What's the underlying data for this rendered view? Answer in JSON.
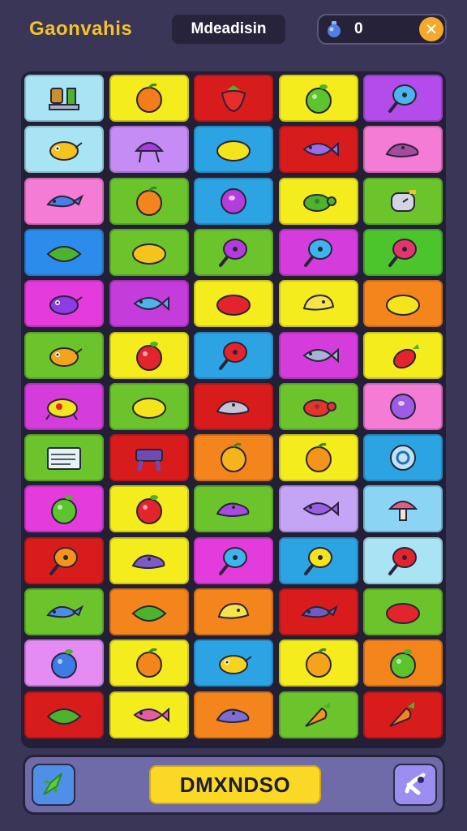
{
  "header": {
    "app_title": "Gaonvahis",
    "mode_label": "Mdeadisin",
    "coin_count": "0",
    "add_coins_symbol": "✕"
  },
  "board": {
    "rows": [
      [
        {
          "bg": "#a8e4f4",
          "icon": "trophy-icon",
          "color": "#c89030"
        },
        {
          "bg": "#f4ec1c",
          "icon": "orange-icon",
          "color": "#f47c1c"
        },
        {
          "bg": "#d81c1c",
          "icon": "strawberry-icon",
          "color": "#e82c2c"
        },
        {
          "bg": "#f4ec1c",
          "icon": "apple-icon",
          "color": "#5cc42c"
        },
        {
          "bg": "#b44cec",
          "icon": "lollipop-icon",
          "color": "#4cb4ec"
        }
      ],
      [
        {
          "bg": "#a8e4f4",
          "icon": "bird-icon",
          "color": "#f4c41c"
        },
        {
          "bg": "#c48cf4",
          "icon": "jellyfish-icon",
          "color": "#a43ce4"
        },
        {
          "bg": "#2ca4e4",
          "icon": "lemon-icon",
          "color": "#f4e41c"
        },
        {
          "bg": "#d81c1c",
          "icon": "fish-icon",
          "color": "#9c6ce4"
        },
        {
          "bg": "#f47cd4",
          "icon": "mouse-icon",
          "color": "#a44c9c"
        }
      ],
      [
        {
          "bg": "#f47cd4",
          "icon": "whale-icon",
          "color": "#4c7ce4"
        },
        {
          "bg": "#6cc42c",
          "icon": "orange-icon",
          "color": "#f4841c"
        },
        {
          "bg": "#2ca4e4",
          "icon": "plum-icon",
          "color": "#b43cdc"
        },
        {
          "bg": "#f4ec1c",
          "icon": "turtle-icon",
          "color": "#4cb42c"
        },
        {
          "bg": "#6cc42c",
          "icon": "watch-icon",
          "color": "#d4d4e4"
        }
      ],
      [
        {
          "bg": "#2c8cec",
          "icon": "leaf-icon",
          "color": "#4cb42c"
        },
        {
          "bg": "#6cc42c",
          "icon": "lemon-icon",
          "color": "#f4c41c"
        },
        {
          "bg": "#6cc42c",
          "icon": "lollipop-icon",
          "color": "#b43cdc"
        },
        {
          "bg": "#d43cdc",
          "icon": "lollipop-icon",
          "color": "#3cb4ec"
        },
        {
          "bg": "#4cc42c",
          "icon": "lollipop-icon",
          "color": "#e4346c"
        }
      ],
      [
        {
          "bg": "#e43cdc",
          "icon": "bird-icon",
          "color": "#8c3ce4"
        },
        {
          "bg": "#c43cdc",
          "icon": "fish-icon",
          "color": "#4cb4ec"
        },
        {
          "bg": "#f4ec1c",
          "icon": "lemon-icon",
          "color": "#e4242c"
        },
        {
          "bg": "#f4ec1c",
          "icon": "chick-icon",
          "color": "#f4e44c"
        },
        {
          "bg": "#f4841c",
          "icon": "lemon-icon",
          "color": "#f4e41c"
        }
      ],
      [
        {
          "bg": "#6cc42c",
          "icon": "bird-icon",
          "color": "#f4a41c"
        },
        {
          "bg": "#f4ec1c",
          "icon": "apple-icon",
          "color": "#e4242c"
        },
        {
          "bg": "#2ca4e4",
          "icon": "lollipop-icon",
          "color": "#e4242c"
        },
        {
          "bg": "#d43cdc",
          "icon": "fish-icon",
          "color": "#a4b4d4"
        },
        {
          "bg": "#f4ec1c",
          "icon": "radish-icon",
          "color": "#e4242c"
        }
      ],
      [
        {
          "bg": "#d43cdc",
          "icon": "bug-icon",
          "color": "#f4e41c"
        },
        {
          "bg": "#6cc42c",
          "icon": "lemon-icon",
          "color": "#f4e41c"
        },
        {
          "bg": "#d81c1c",
          "icon": "mouse-icon",
          "color": "#c4c4d4"
        },
        {
          "bg": "#6cc42c",
          "icon": "turtle-icon",
          "color": "#e4342c"
        },
        {
          "bg": "#f47cd4",
          "icon": "plum-icon",
          "color": "#9c5ce4"
        }
      ],
      [
        {
          "bg": "#6cc42c",
          "icon": "note-card-icon",
          "color": "#e4f4f4"
        },
        {
          "bg": "#d81c1c",
          "icon": "table-icon",
          "color": "#6c4cb4"
        },
        {
          "bg": "#f4841c",
          "icon": "orange-icon",
          "color": "#f4b41c"
        },
        {
          "bg": "#f4ec1c",
          "icon": "orange-icon",
          "color": "#f4941c"
        },
        {
          "bg": "#2ca4e4",
          "icon": "donut-icon",
          "color": "#bce4f4"
        }
      ],
      [
        {
          "bg": "#e43cdc",
          "icon": "apple-icon",
          "color": "#5cc42c"
        },
        {
          "bg": "#f4ec1c",
          "icon": "apple-icon",
          "color": "#e4242c"
        },
        {
          "bg": "#6cc42c",
          "icon": "mouse-icon",
          "color": "#a44cdc"
        },
        {
          "bg": "#c4a4f4",
          "icon": "fish-icon",
          "color": "#9c5ce4"
        },
        {
          "bg": "#8cd4f4",
          "icon": "mushroom-icon",
          "color": "#e45c84"
        }
      ],
      [
        {
          "bg": "#d81c1c",
          "icon": "lollipop-icon",
          "color": "#f4941c"
        },
        {
          "bg": "#f4ec1c",
          "icon": "mouse-icon",
          "color": "#7c5cc4"
        },
        {
          "bg": "#e43cdc",
          "icon": "lollipop-icon",
          "color": "#3cb4ec"
        },
        {
          "bg": "#2ca4e4",
          "icon": "lollipop-icon",
          "color": "#f4e41c"
        },
        {
          "bg": "#a8e4f4",
          "icon": "lollipop-icon",
          "color": "#e4242c"
        }
      ],
      [
        {
          "bg": "#6cc42c",
          "icon": "whale-icon",
          "color": "#4c8ce4"
        },
        {
          "bg": "#f4841c",
          "icon": "leaf-icon",
          "color": "#4cb42c"
        },
        {
          "bg": "#f4841c",
          "icon": "chick-icon",
          "color": "#f4e44c"
        },
        {
          "bg": "#d81c1c",
          "icon": "whale-icon",
          "color": "#6c5cc4"
        },
        {
          "bg": "#6cc42c",
          "icon": "lemon-icon",
          "color": "#e4242c"
        }
      ],
      [
        {
          "bg": "#e48cf4",
          "icon": "apple-icon",
          "color": "#3c7ce4"
        },
        {
          "bg": "#f4ec1c",
          "icon": "orange-icon",
          "color": "#f4841c"
        },
        {
          "bg": "#2ca4e4",
          "icon": "bird-icon",
          "color": "#f4d41c"
        },
        {
          "bg": "#f4ec1c",
          "icon": "orange-icon",
          "color": "#f4a41c"
        },
        {
          "bg": "#f4841c",
          "icon": "apple-icon",
          "color": "#5cc42c"
        }
      ],
      [
        {
          "bg": "#d81c1c",
          "icon": "leaf-icon",
          "color": "#4cb42c"
        },
        {
          "bg": "#f4ec1c",
          "icon": "fish-icon",
          "color": "#e45ca4"
        },
        {
          "bg": "#f4841c",
          "icon": "mouse-icon",
          "color": "#7c6cd4"
        },
        {
          "bg": "#6cc42c",
          "icon": "carrot-icon",
          "color": "#f4941c"
        },
        {
          "bg": "#d81c1c",
          "icon": "carrot-icon",
          "color": "#f4841c"
        }
      ]
    ]
  },
  "footer": {
    "action_label": "DMXNDSO",
    "left_icon": "rocket-icon",
    "right_icon": "shuffle-icon"
  }
}
